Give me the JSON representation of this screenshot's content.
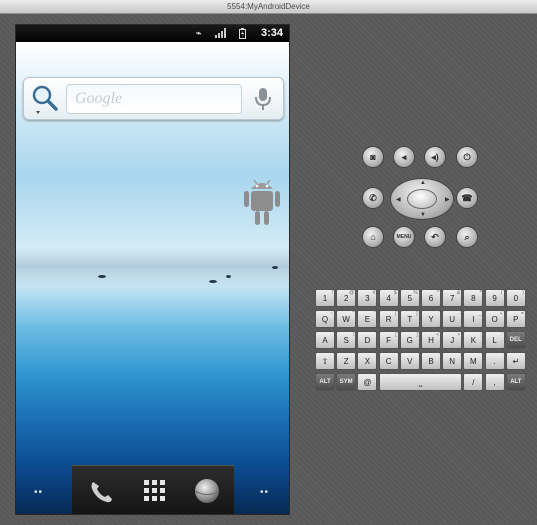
{
  "window": {
    "title": "5554:MyAndroidDevice"
  },
  "status_bar": {
    "time": "3:34",
    "icons": [
      "usb-icon",
      "signal-icon",
      "battery-icon"
    ]
  },
  "search_widget": {
    "placeholder": "Google",
    "icons": [
      "magnifier-icon",
      "microphone-icon"
    ]
  },
  "dock": {
    "icons": [
      "phone-icon",
      "app-grid-icon",
      "browser-globe-icon"
    ]
  },
  "page_dots": {
    "left": "••",
    "right": "••"
  },
  "controls": {
    "row1": [
      {
        "name": "camera-button",
        "glyph": "◙"
      },
      {
        "name": "volume-down-button",
        "glyph": "◂"
      },
      {
        "name": "volume-up-button",
        "glyph": "◂)"
      },
      {
        "name": "power-button",
        "glyph": "⏻"
      }
    ],
    "row2": [
      {
        "name": "call-button",
        "glyph": "✆"
      },
      {
        "name": "end-call-button",
        "glyph": "☎"
      }
    ],
    "row3": [
      {
        "name": "home-button",
        "glyph": "⌂"
      },
      {
        "name": "menu-button",
        "glyph": "MENU"
      },
      {
        "name": "back-button",
        "glyph": "↶"
      },
      {
        "name": "search-button",
        "glyph": "⌕"
      }
    ]
  },
  "keyboard": {
    "rows": [
      [
        [
          "1",
          "!"
        ],
        [
          "2",
          "@"
        ],
        [
          "3",
          "#"
        ],
        [
          "4",
          "$"
        ],
        [
          "5",
          "%"
        ],
        [
          "6",
          "^"
        ],
        [
          "7",
          "&"
        ],
        [
          "8",
          "*"
        ],
        [
          "9",
          "("
        ],
        [
          "0",
          ")"
        ]
      ],
      [
        [
          "Q",
          "~"
        ],
        [
          "W",
          "\""
        ],
        [
          "E",
          "'"
        ],
        [
          "R",
          "{"
        ],
        [
          "T",
          "}"
        ],
        [
          "Y",
          ""
        ],
        [
          "U",
          "-"
        ],
        [
          "I",
          "_"
        ],
        [
          "O",
          "+"
        ],
        [
          "P",
          "="
        ]
      ],
      [
        [
          "A",
          ""
        ],
        [
          "S",
          "\\"
        ],
        [
          "D",
          ""
        ],
        [
          "F",
          "["
        ],
        [
          "G",
          "]"
        ],
        [
          "H",
          "<"
        ],
        [
          "J",
          ">"
        ],
        [
          "K",
          ";"
        ],
        [
          "L",
          ":"
        ]
      ],
      [
        [
          "Z",
          ""
        ],
        [
          "X",
          ""
        ],
        [
          "C",
          ""
        ],
        [
          "V",
          ""
        ],
        [
          "B",
          ""
        ],
        [
          "N",
          ""
        ],
        [
          "M",
          ""
        ],
        [
          ".",
          ""
        ]
      ]
    ],
    "special": {
      "del": "DEL",
      "shift": "⇧",
      "enter": "↵",
      "alt": "ALT",
      "sym": "SYM",
      "at": "@",
      "space": "⎵",
      "slash": "/",
      "comma": ","
    }
  }
}
